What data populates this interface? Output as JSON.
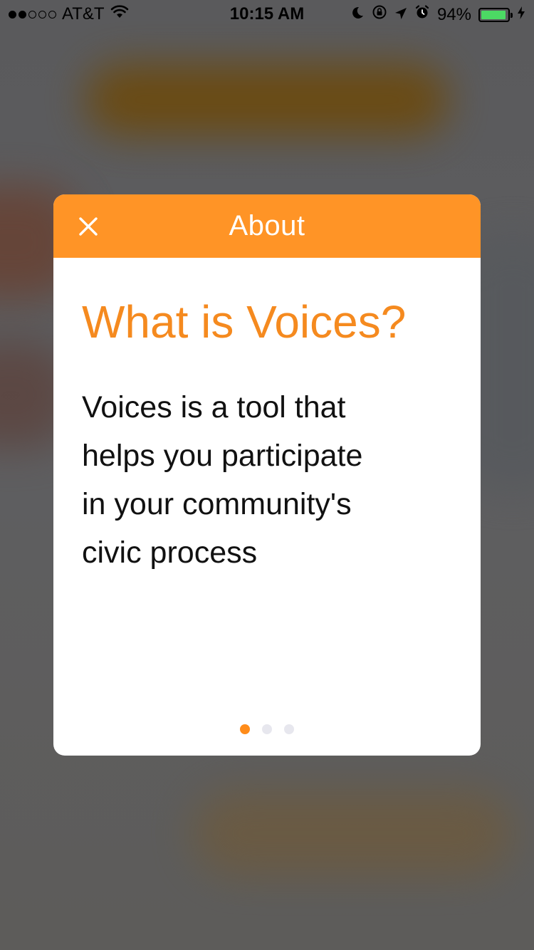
{
  "status_bar": {
    "carrier": "AT&T",
    "time": "10:15 AM",
    "battery_percent": "94%",
    "battery_level": 0.94,
    "signal_bars_filled": 2,
    "signal_bars_total": 5,
    "icons": [
      "wifi-icon",
      "moon-icon",
      "orientation-lock-icon",
      "location-arrow-icon",
      "alarm-icon",
      "battery-icon",
      "charging-bolt-icon"
    ]
  },
  "modal": {
    "title": "About",
    "close_icon": "close-icon",
    "headline": "What is Voices?",
    "body_lines": [
      "Voices is a tool that",
      "helps you participate",
      "in your community's",
      "civic process"
    ],
    "pager": {
      "total": 3,
      "current": 1
    }
  },
  "colors": {
    "accent": "#ff9426",
    "headline": "#f58a1f",
    "battery_fill": "#4cd964",
    "pager_inactive": "#e7e7ee"
  }
}
